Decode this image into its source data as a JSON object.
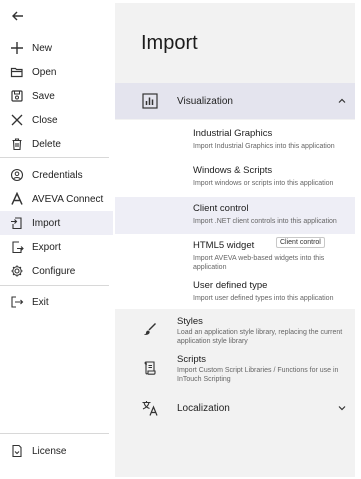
{
  "sidebar": {
    "items": [
      {
        "label": "New",
        "icon": "plus-icon"
      },
      {
        "label": "Open",
        "icon": "folder-open-icon"
      },
      {
        "label": "Save",
        "icon": "save-icon"
      },
      {
        "label": "Close",
        "icon": "close-icon"
      },
      {
        "label": "Delete",
        "icon": "trash-icon"
      },
      {
        "label": "Credentials",
        "icon": "user-circle-icon"
      },
      {
        "label": "AVEVA Connect",
        "icon": "aveva-logo-icon"
      },
      {
        "label": "Import",
        "icon": "import-icon"
      },
      {
        "label": "Export",
        "icon": "export-icon"
      },
      {
        "label": "Configure",
        "icon": "gear-icon"
      },
      {
        "label": "Exit",
        "icon": "exit-icon"
      }
    ],
    "license_label": "License",
    "active": "Import"
  },
  "main": {
    "title": "Import",
    "visualization": {
      "label": "Visualization",
      "items": [
        {
          "title": "Industrial Graphics",
          "desc": "Import Industrial Graphics into this application"
        },
        {
          "title": "Windows & Scripts",
          "desc": "Import windows or scripts into this application"
        },
        {
          "title": "Client control",
          "desc": "Import .NET client controls into this application"
        },
        {
          "title": "HTML5 widget",
          "desc": "Import AVEVA web-based widgets into this application",
          "tag": "Client control"
        },
        {
          "title": "User defined type",
          "desc": "Import user defined types into this application"
        }
      ]
    },
    "styles": {
      "title": "Styles",
      "desc": "Load an application style library, replacing the current application style library"
    },
    "scripts": {
      "title": "Scripts",
      "desc": "Import Custom Script Libraries / Functions for use in InTouch Scripting"
    },
    "localization": {
      "label": "Localization"
    }
  },
  "colors": {
    "active_bg": "#eeeef6",
    "expanded_bg": "#e4e4ee",
    "panel_bg": "#f2f2f2"
  }
}
